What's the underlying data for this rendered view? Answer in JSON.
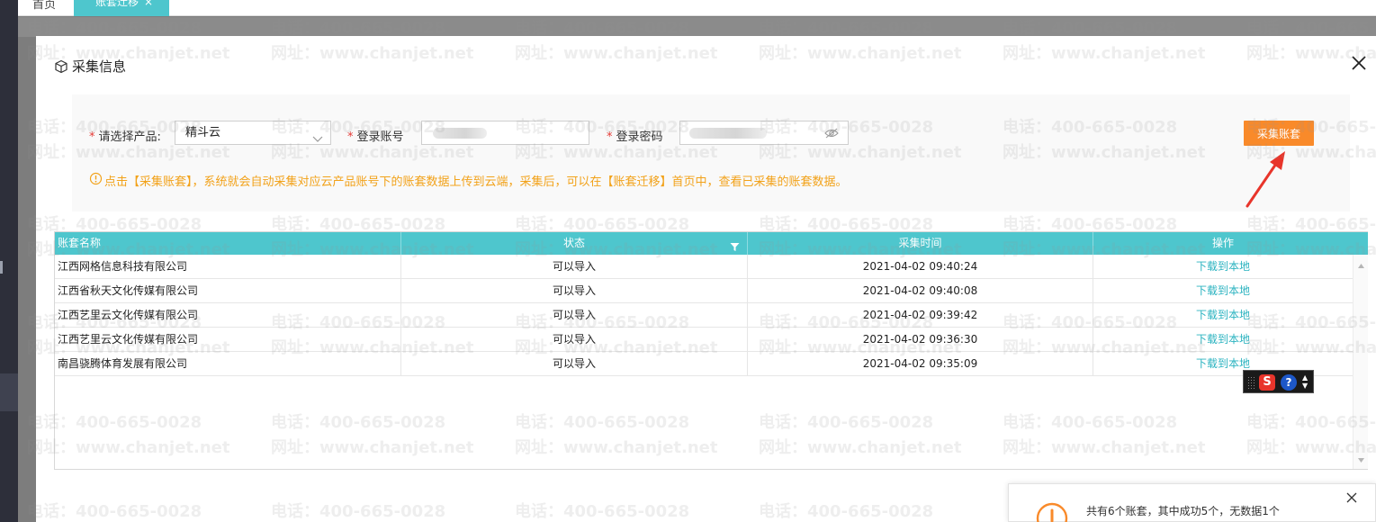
{
  "tabs": {
    "home_label": "首页",
    "active_label": "账套迁移",
    "active_close": "×"
  },
  "modal": {
    "title": "采集信息",
    "close_icon": "close-icon"
  },
  "form": {
    "product_label": "请选择产品:",
    "product_value": "精斗云",
    "account_label": "登录账号",
    "password_label": "登录密码",
    "required_mark": "*",
    "collect_button": "采集账套",
    "tip": "点击【采集账套】，系统就会自动采集对应云产品账号下的账套数据上传到云端，采集后，可以在【账套迁移】首页中，查看已采集的账套数据。"
  },
  "table": {
    "columns": [
      "账套名称",
      "状态",
      "采集时间",
      "操作"
    ],
    "rows": [
      {
        "name": "江西网格信息科技有限公司",
        "status": "可以导入",
        "time": "2021-04-02 09:40:24",
        "action": "下载到本地"
      },
      {
        "name": "江西省秋天文化传媒有限公司",
        "status": "可以导入",
        "time": "2021-04-02 09:40:08",
        "action": "下载到本地"
      },
      {
        "name": "江西艺里云文化传媒有限公司",
        "status": "可以导入",
        "time": "2021-04-02 09:39:42",
        "action": "下载到本地"
      },
      {
        "name": "江西艺里云文化传媒有限公司",
        "status": "可以导入",
        "time": "2021-04-02 09:36:30",
        "action": "下载到本地"
      },
      {
        "name": "南昌骁腾体育发展有限公司",
        "status": "可以导入",
        "time": "2021-04-02 09:35:09",
        "action": "下载到本地"
      }
    ]
  },
  "ime": {
    "logo_letter": "S",
    "help_glyph": "?"
  },
  "toast": {
    "message": "共有6个账套，其中成功5个，无数据1个"
  },
  "watermark": {
    "phone": "电话：400-665-0028",
    "site": "网址：www.chanjet.net"
  },
  "colors": {
    "accent_teal": "#4ec6cd",
    "button_orange": "#f98a2a",
    "tip_orange": "#f2a21a",
    "required_red": "#e53935",
    "link_teal": "#2bb3c0",
    "arrow_red": "#e8352b"
  }
}
